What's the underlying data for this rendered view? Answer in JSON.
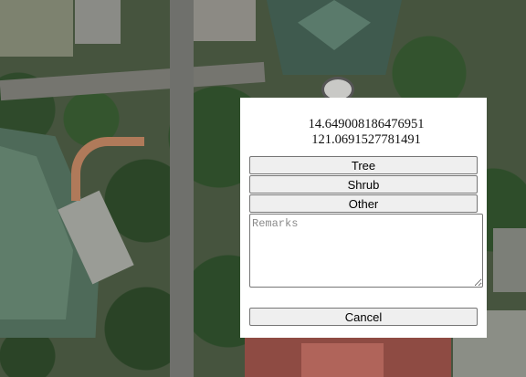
{
  "popup": {
    "latitude": "14.649008186476951",
    "longitude": "121.0691527781491",
    "buttons": {
      "tree": "Tree",
      "shrub": "Shrub",
      "other": "Other"
    },
    "remarks_placeholder": "Remarks",
    "remarks_value": "",
    "cancel": "Cancel"
  }
}
